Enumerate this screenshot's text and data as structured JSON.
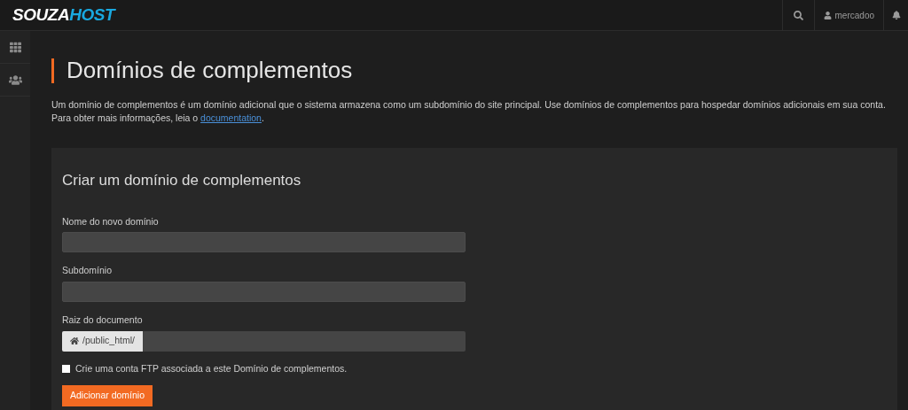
{
  "header": {
    "logo": {
      "part_1": "SOUZA",
      "part_2": "HOST"
    },
    "user": "mercadoo"
  },
  "page": {
    "title": "Domínios de complementos",
    "description": {
      "text": "Um domínio de complementos é um domínio adicional que o sistema armazena como um subdomínio do site principal. Use domínios de complementos para hospedar domínios adicionais em sua conta. Para obter mais informações, leia o ",
      "link": "documentation",
      "text_after": "."
    }
  },
  "form": {
    "title": "Criar um domínio de complementos",
    "fields": [
      {
        "kind": "text",
        "label": "Nome do novo domínio"
      },
      {
        "kind": "text",
        "label": "Subdomínio"
      },
      {
        "kind": "prefixed",
        "label": "Raiz do documento",
        "prefix": "/public_html/"
      }
    ],
    "checkbox": {
      "label": "Crie uma conta FTP associada a este Domínio de complementos.",
      "checked": false
    },
    "submit": "Adicionar domínio"
  }
}
